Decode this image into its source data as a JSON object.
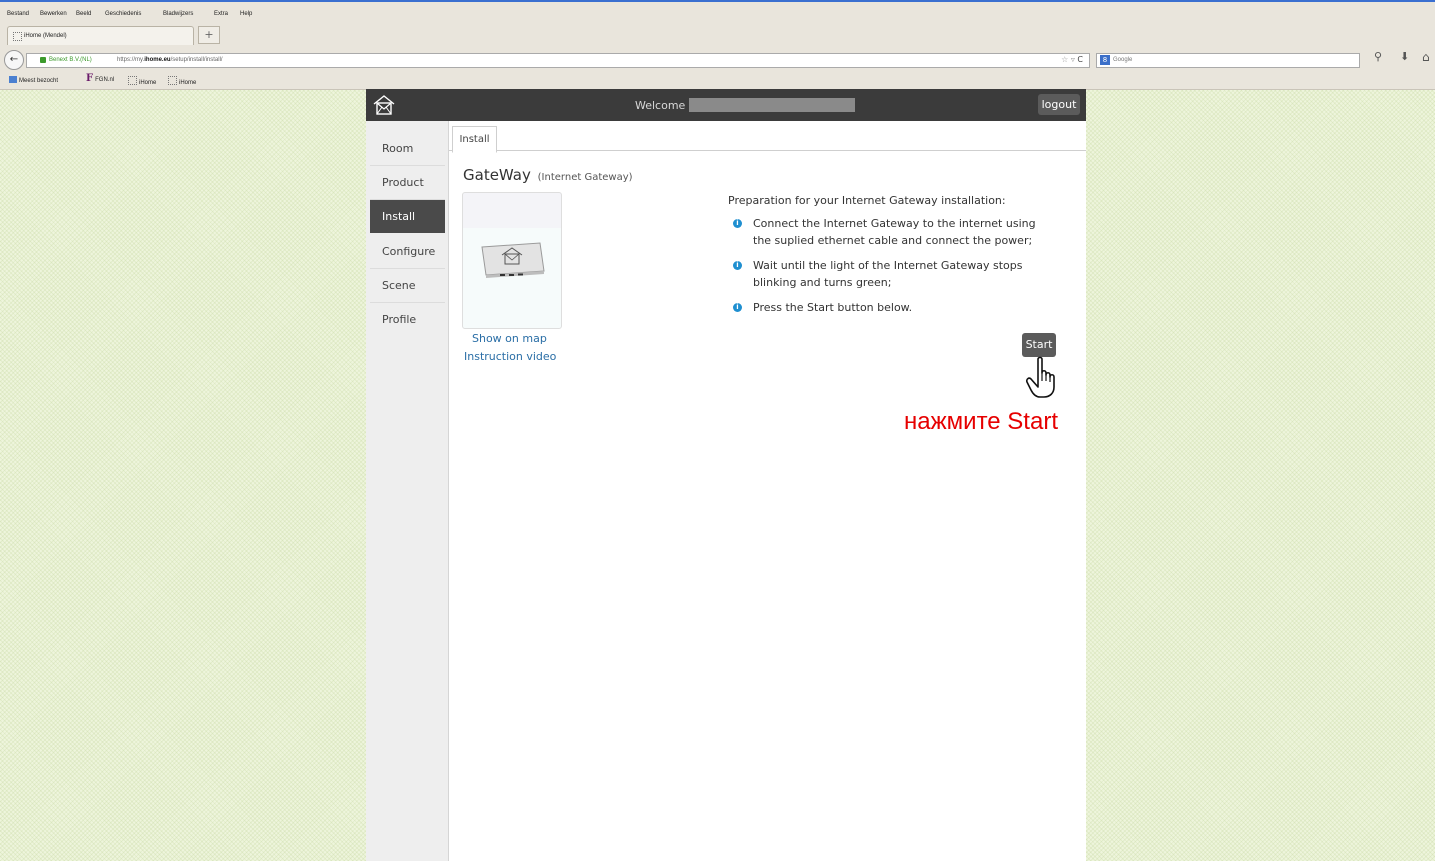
{
  "browser": {
    "menu": [
      "Bestand",
      "Bewerken",
      "Beeld",
      "Geschiedenis",
      "Bladwijzers",
      "Extra",
      "Help"
    ],
    "tab_title": "iHome (Mendel)",
    "new_tab": "+",
    "site_identity": "Benext B.V.(NL)",
    "url_prefix": "https://my.",
    "url_domain": "ihome.eu",
    "url_path": "/setup/install/install/",
    "search_placeholder": "Google",
    "bookmarks": [
      "Meest bezocht",
      "FGN.nl",
      "iHome",
      "iHome"
    ]
  },
  "header": {
    "welcome": "Welcome",
    "logout": "logout"
  },
  "sidebar": {
    "items": [
      {
        "label": "Room",
        "active": false
      },
      {
        "label": "Product",
        "active": false
      },
      {
        "label": "Install",
        "active": true
      },
      {
        "label": "Configure",
        "active": false
      },
      {
        "label": "Scene",
        "active": false
      },
      {
        "label": "Profile",
        "active": false
      }
    ]
  },
  "main": {
    "tab": "Install",
    "device_title": "GateWay",
    "device_subtitle": "(Internet Gateway)",
    "show_on_map": "Show on map",
    "instruction_video": "Instruction video",
    "prep_title": "Preparation for your Internet Gateway installation:",
    "steps": [
      "Connect the Internet Gateway to the internet using the suplied ethernet cable and connect the power;",
      "Wait until the light of the Internet Gateway stops blinking and turns green;",
      "Press the Start button below."
    ],
    "start": "Start",
    "annotation": "нажмите Start"
  },
  "colors": {
    "header_bg": "#3b3b3b",
    "active_bg": "#4a4a4a",
    "link": "#2a6ea6",
    "bullet": "#1f8fd0",
    "annotation": "#e60000"
  }
}
